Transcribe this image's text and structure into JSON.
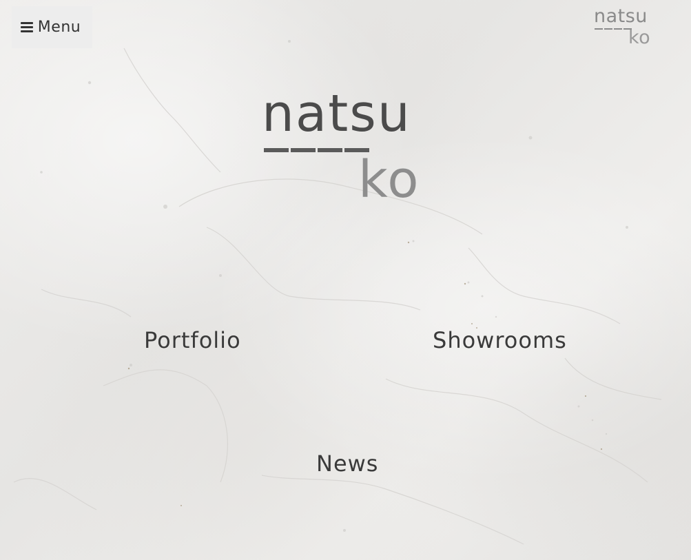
{
  "header": {
    "menu_label": "Menu",
    "menu_icon": "hamburger-icon"
  },
  "logo": {
    "line1": "natsu",
    "line2": "ko"
  },
  "nav": {
    "portfolio": "Portfolio",
    "showrooms": "Showrooms",
    "news": "News"
  },
  "colors": {
    "text_dark": "#3a3a3a",
    "logo_dark": "#4b4b4b",
    "logo_light": "#8d8d8d",
    "background": "#ecebea"
  }
}
